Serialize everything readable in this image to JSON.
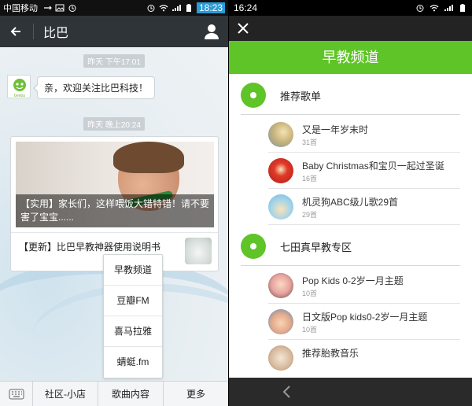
{
  "left": {
    "statusbar": {
      "carrier": "中国移动",
      "time": "18:23"
    },
    "titlebar": {
      "title": "比巴"
    },
    "chat": {
      "timestamp1": "昨天 下午17:01",
      "avatar_label": "beeba",
      "welcome": "亲，欢迎关注比巴科技！",
      "timestamp2": "昨天 晚上20:24",
      "news_caption": "【实用】家长们，这样喂饭大错特错！请不要害了宝宝......",
      "news_item2": "【更新】比巴早教神器使用说明书"
    },
    "popup": {
      "items": [
        "早教频道",
        "豆瓣FM",
        "喜马拉雅",
        "蜻蜓.fm"
      ]
    },
    "bottombar": {
      "menus": [
        "社区-小店",
        "歌曲内容",
        "更多"
      ]
    }
  },
  "right": {
    "statusbar": {
      "time": "16:24"
    },
    "header": {
      "title": "早教频道"
    },
    "section1": {
      "title": "推荐歌单",
      "songs": [
        {
          "name": "又是一年岁末时",
          "count": "31首"
        },
        {
          "name": "Baby Christmas和宝贝一起过圣诞",
          "count": "16首"
        },
        {
          "name": "机灵狗ABC级儿歌29首",
          "count": "29首"
        }
      ]
    },
    "section2": {
      "title": "七田真早教专区",
      "songs": [
        {
          "name": "Pop Kids 0-2岁一月主题",
          "count": "10首"
        },
        {
          "name": "日文版Pop kids0-2岁一月主题",
          "count": "10首"
        },
        {
          "name": "推荐胎教音乐",
          "count": ""
        }
      ]
    },
    "colors": {
      "accent": "#5fc427"
    }
  }
}
